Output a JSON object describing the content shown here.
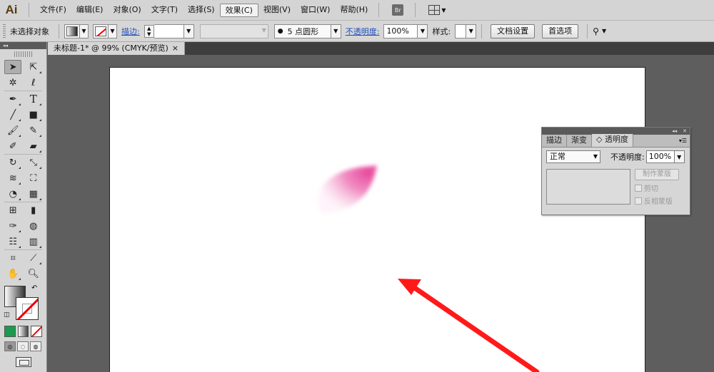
{
  "app": {
    "logo": "Ai"
  },
  "menu": {
    "items": [
      "文件(F)",
      "编辑(E)",
      "对象(O)",
      "文字(T)",
      "选择(S)",
      "效果(C)",
      "视图(V)",
      "窗口(W)",
      "帮助(H)"
    ],
    "active": "效果(C)",
    "bridge_label": "Br"
  },
  "control": {
    "selection": "未选择对象",
    "stroke_link": "描边:",
    "brush_value": "5 点圆形",
    "opacity_link": "不透明度:",
    "opacity_value": "100%",
    "style_label": "样式:",
    "doc_setup": "文档设置",
    "preferences": "首选项"
  },
  "document": {
    "tab_title": "未标题-1* @ 99% (CMYK/预览)",
    "tab_close": "×"
  },
  "transparency_panel": {
    "tabs": [
      "描边",
      "渐变",
      "◇ 透明度"
    ],
    "active_tab": "◇ 透明度",
    "blend_mode": "正常",
    "opacity_label": "不透明度:",
    "opacity_value": "100%",
    "make_mask": "制作蒙版",
    "clip": "剪切",
    "invert_mask": "反相蒙版"
  },
  "colors": {
    "petal": "#e8479b",
    "arrow": "#ff1a1a",
    "chrome": "#d6d6d6"
  },
  "icons": [
    "selection-icon",
    "direct-selection-icon",
    "magic-wand-icon",
    "lasso-icon",
    "pen-icon",
    "type-icon",
    "line-icon",
    "rectangle-icon",
    "paintbrush-icon",
    "pencil-icon",
    "blob-brush-icon",
    "eraser-icon",
    "rotate-icon",
    "scale-icon",
    "warp-icon",
    "free-transform-icon",
    "shape-builder-icon",
    "perspective-grid-icon",
    "mesh-icon",
    "gradient-icon",
    "eyedropper-icon",
    "blend-icon",
    "symbol-sprayer-icon",
    "column-graph-icon",
    "artboard-icon",
    "slice-icon",
    "hand-icon",
    "zoom-icon"
  ]
}
